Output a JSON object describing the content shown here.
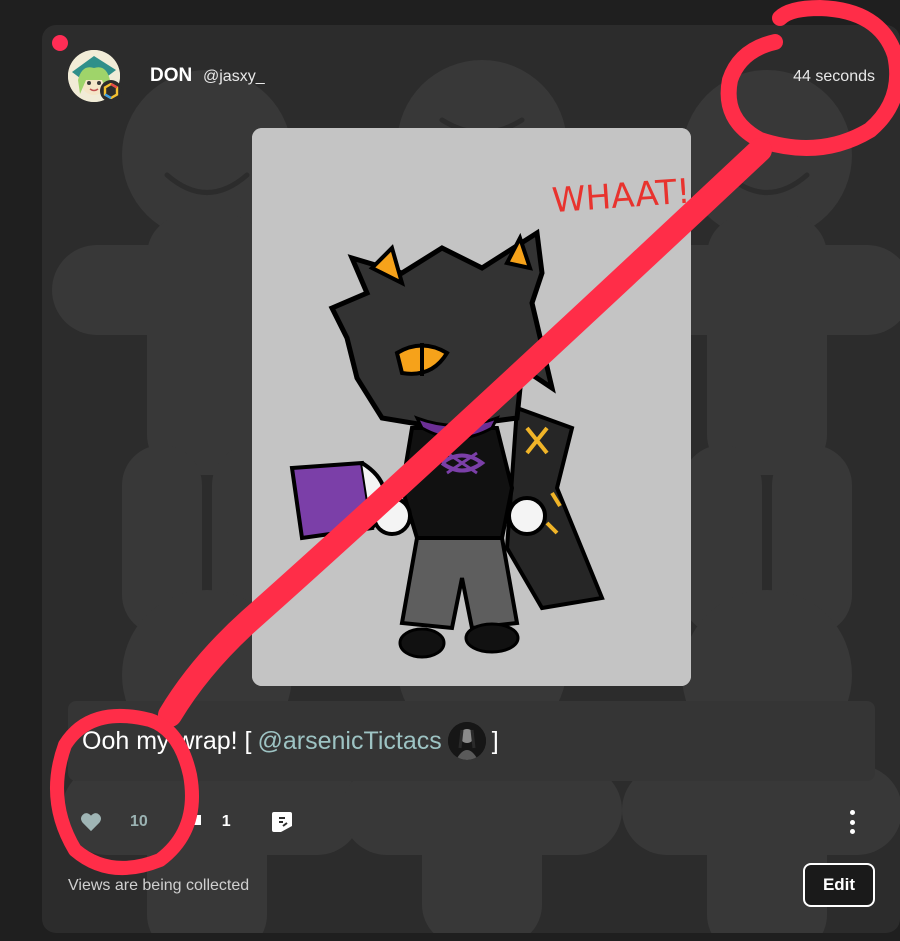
{
  "post": {
    "author": {
      "name": "DON",
      "handle": "@jasxy_"
    },
    "timestamp": "44 seconds",
    "artwork": {
      "scribble_text": "WHAAT!"
    },
    "caption": {
      "text_before": "Ooh my wrap! [",
      "mention": "@arsenicTictacs",
      "text_after": "]"
    },
    "actions": {
      "likes": "10",
      "comments": "1"
    },
    "views_text": "Views are being collected",
    "edit_label": "Edit"
  },
  "colors": {
    "background": "#1f1f1f",
    "card": "#2c2c2c",
    "mention": "#9dc3c3",
    "annotation_red": "#ff2d48",
    "status_dot": "#ff2d55"
  },
  "icons": [
    "heart-icon",
    "comment-icon",
    "share-icon",
    "more-icon",
    "pin-badge-icon"
  ]
}
